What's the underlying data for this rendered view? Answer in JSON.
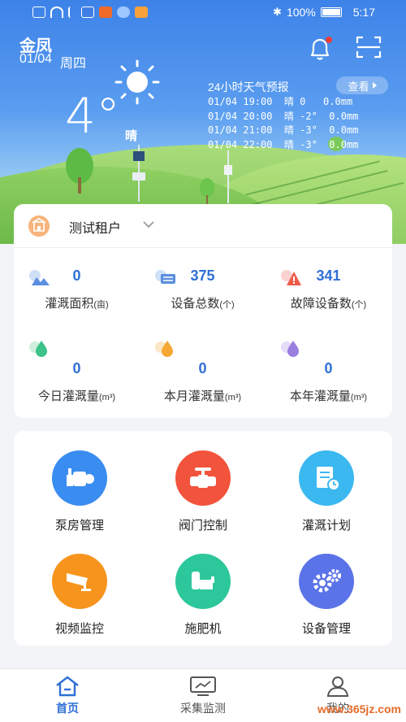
{
  "status_bar": {
    "battery": "100%",
    "time": "5:17"
  },
  "header": {
    "location": "金凤",
    "date": "01/04",
    "weekday": "周四"
  },
  "weather": {
    "temperature": "4°",
    "condition": "晴",
    "forecast_title": "24小时天气预报",
    "view_label": "查看",
    "forecast_rows": [
      "01/04 19:00  晴 0   0.0mm",
      "01/04 20:00  晴 -2°  0.0mm",
      "01/04 21:00  晴 -3°  0.0mm",
      "01/04 22:00  晴 -3°  0.0mm"
    ]
  },
  "tenant": {
    "name": "测试租户"
  },
  "stats": [
    {
      "value": "0",
      "label": "灌溉面积",
      "unit": "(亩)",
      "icon": "area-icon"
    },
    {
      "value": "375",
      "label": "设备总数",
      "unit": "(个)",
      "icon": "device-count-icon"
    },
    {
      "value": "341",
      "label": "故障设备数",
      "unit": "(个)",
      "icon": "fault-warning-icon"
    },
    {
      "value": "0",
      "label": "今日灌溉量",
      "unit": "(m³)",
      "icon": "day-drop-icon"
    },
    {
      "value": "0",
      "label": "本月灌溉量",
      "unit": "(m³)",
      "icon": "month-drop-icon"
    },
    {
      "value": "0",
      "label": "本年灌溉量",
      "unit": "(m³)",
      "icon": "year-drop-icon"
    }
  ],
  "functions": [
    {
      "label": "泵房管理",
      "icon": "pump-icon",
      "color": "#3a8df0"
    },
    {
      "label": "阀门控制",
      "icon": "valve-icon",
      "color": "#f2533c"
    },
    {
      "label": "灌溉计划",
      "icon": "plan-icon",
      "color": "#3bb8f0"
    },
    {
      "label": "视频监控",
      "icon": "camera-icon",
      "color": "#f7941d"
    },
    {
      "label": "施肥机",
      "icon": "fertilizer-icon",
      "color": "#2cc79a"
    },
    {
      "label": "设备管理",
      "icon": "gears-icon",
      "color": "#5b73e8"
    }
  ],
  "tabs": [
    {
      "label": "首页",
      "icon": "home-icon"
    },
    {
      "label": "采集监测",
      "icon": "monitor-icon"
    },
    {
      "label": "我的",
      "icon": "user-icon"
    }
  ],
  "watermark": "www.365jz.com"
}
